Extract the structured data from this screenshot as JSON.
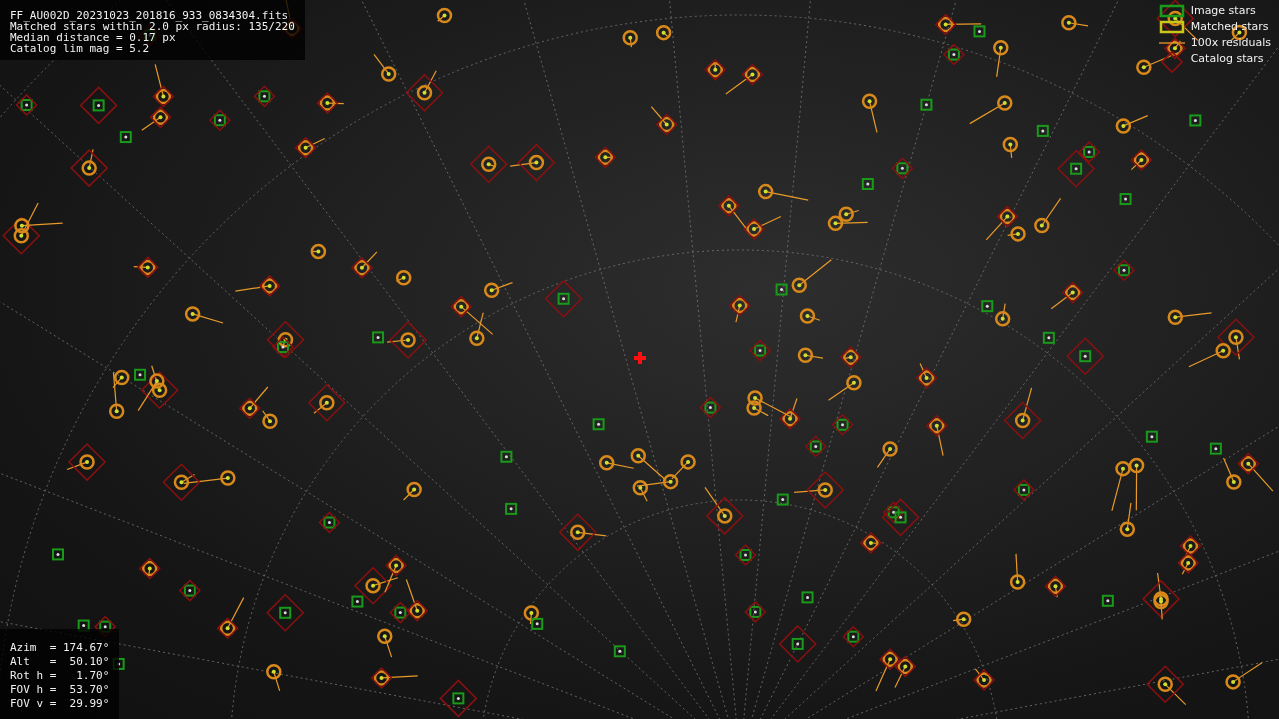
{
  "info": {
    "lines": [
      "FF_AU002D_20231023_201816_933_0834304.fits",
      "Matched stars within 2.0 px radius: 135/220",
      "Median distance = 0.17 px",
      "Catalog lim mag = 5.2"
    ]
  },
  "legend": [
    {
      "kind": "image",
      "label": "Image stars"
    },
    {
      "kind": "matched",
      "label": "Matched stars"
    },
    {
      "kind": "residual",
      "label": "100x residuals"
    },
    {
      "kind": "catalog",
      "label": "Catalog stars"
    }
  ],
  "pointing": {
    "lines": [
      "Azim  = 174.67°",
      "Alt   =  50.10°",
      "Rot h =   1.70°",
      "FOV h =  53.70°",
      "FOV v =  29.99°"
    ]
  }
}
